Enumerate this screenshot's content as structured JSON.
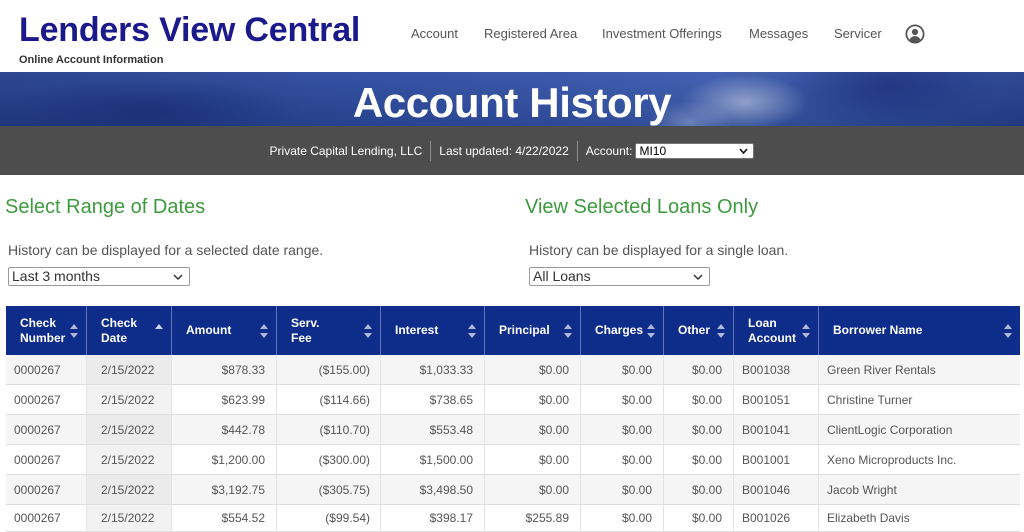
{
  "header": {
    "logo_title": "Lenders View Central",
    "logo_subtitle": "Online Account Information",
    "nav": {
      "account": "Account",
      "registered_area": "Registered Area",
      "investment_offerings": "Investment Offerings",
      "messages": "Messages",
      "servicer": "Servicer"
    }
  },
  "banner": {
    "title": "Account History"
  },
  "account_bar": {
    "lender_name": "Private Capital Lending, LLC",
    "last_updated": "Last updated: 4/22/2022",
    "account_label": "Account:",
    "account_selected": "MI10"
  },
  "date_filter": {
    "heading": "Select Range of Dates",
    "description": "History can be displayed for a selected date range.",
    "selected": "Last 3 months"
  },
  "loan_filter": {
    "heading": "View Selected Loans Only",
    "description": "History can be displayed for a single loan.",
    "selected": "All Loans"
  },
  "table": {
    "columns": [
      "Check Number",
      "Check Date",
      "Amount",
      "Serv. Fee",
      "Interest",
      "Principal",
      "Charges",
      "Other",
      "Loan Account",
      "Borrower Name"
    ],
    "rows": [
      {
        "check_number": "0000267",
        "check_date": "2/15/2022",
        "amount": "$878.33",
        "serv_fee": "($155.00)",
        "interest": "$1,033.33",
        "principal": "$0.00",
        "charges": "$0.00",
        "other": "$0.00",
        "loan_account": "B001038",
        "borrower_name": "Green River Rentals"
      },
      {
        "check_number": "0000267",
        "check_date": "2/15/2022",
        "amount": "$623.99",
        "serv_fee": "($114.66)",
        "interest": "$738.65",
        "principal": "$0.00",
        "charges": "$0.00",
        "other": "$0.00",
        "loan_account": "B001051",
        "borrower_name": "Christine Turner"
      },
      {
        "check_number": "0000267",
        "check_date": "2/15/2022",
        "amount": "$442.78",
        "serv_fee": "($110.70)",
        "interest": "$553.48",
        "principal": "$0.00",
        "charges": "$0.00",
        "other": "$0.00",
        "loan_account": "B001041",
        "borrower_name": "ClientLogic Corporation"
      },
      {
        "check_number": "0000267",
        "check_date": "2/15/2022",
        "amount": "$1,200.00",
        "serv_fee": "($300.00)",
        "interest": "$1,500.00",
        "principal": "$0.00",
        "charges": "$0.00",
        "other": "$0.00",
        "loan_account": "B001001",
        "borrower_name": "Xeno Microproducts Inc."
      },
      {
        "check_number": "0000267",
        "check_date": "2/15/2022",
        "amount": "$3,192.75",
        "serv_fee": "($305.75)",
        "interest": "$3,498.50",
        "principal": "$0.00",
        "charges": "$0.00",
        "other": "$0.00",
        "loan_account": "B001046",
        "borrower_name": "Jacob Wright"
      },
      {
        "check_number": "0000267",
        "check_date": "2/15/2022",
        "amount": "$554.52",
        "serv_fee": "($99.54)",
        "interest": "$398.17",
        "principal": "$255.89",
        "charges": "$0.00",
        "other": "$0.00",
        "loan_account": "B001026",
        "borrower_name": "Elizabeth Davis"
      }
    ]
  },
  "icons": {
    "user": "user-circle-icon",
    "select_chevron": "chevron-down-icon",
    "sort": "sort-icon",
    "sort_active": "sort-ascending-icon"
  },
  "colors": {
    "brand": "#1b1a8c",
    "table_header": "#0e2d8b",
    "section_heading": "#3e9a3e",
    "info_bar": "#4d4d4d",
    "banner": "#2f4ea3"
  }
}
